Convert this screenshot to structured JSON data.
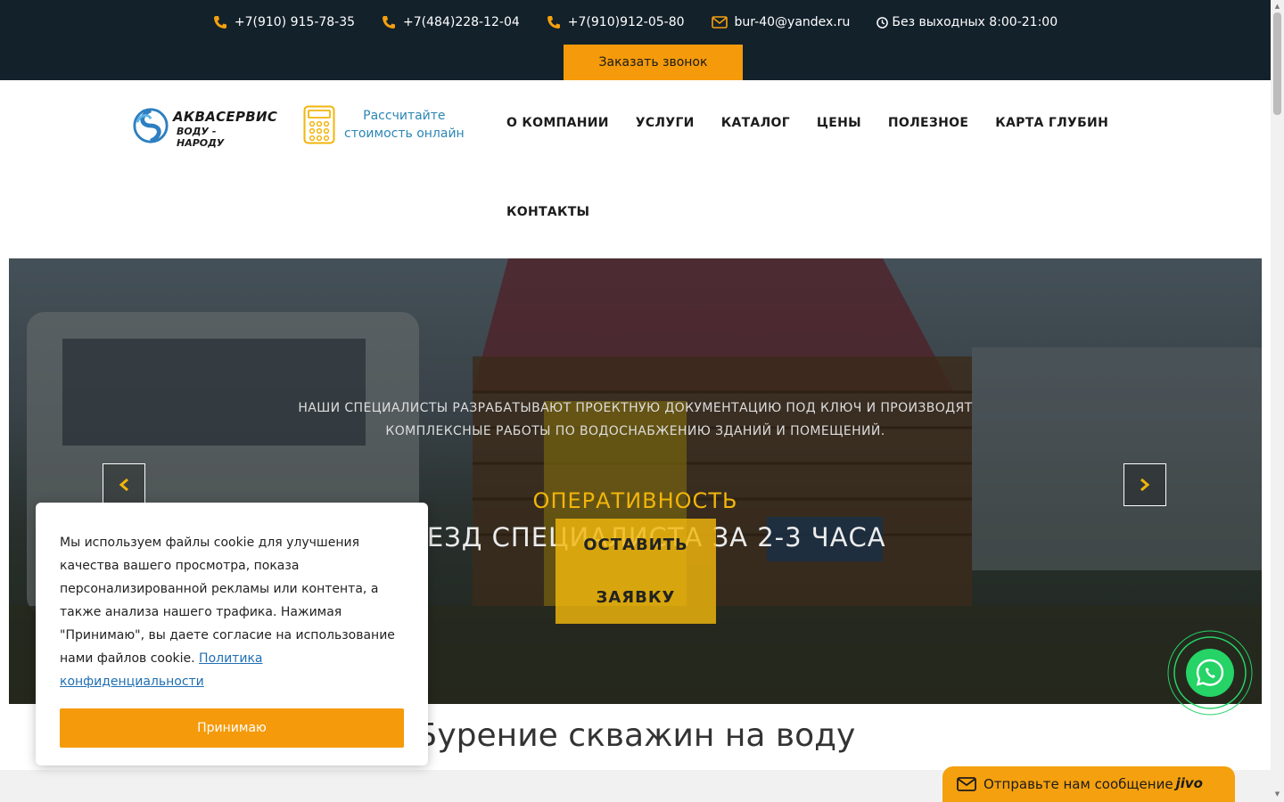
{
  "topbar": {
    "contacts": [
      {
        "icon": "phone-icon",
        "text": "+7(910) 915-78-35"
      },
      {
        "icon": "phone-icon",
        "text": "+7(484)228-12-04"
      },
      {
        "icon": "phone-icon",
        "text": "+7(910)912-05-80"
      },
      {
        "icon": "envelope-icon",
        "text": "bur-40@yandex.ru"
      },
      {
        "icon": "clock-icon",
        "text": "Без выходных 8:00-21:00"
      }
    ],
    "callback_label": "Заказать звонок"
  },
  "header": {
    "logo": {
      "line1": "АКВАСЕРВИС",
      "line2": "ВОДУ - НАРОДУ"
    },
    "calc": {
      "line1": "Рассчитайте",
      "line2": "стоимость онлайн"
    },
    "nav": [
      "О КОМПАНИИ",
      "УСЛУГИ",
      "КАТАЛОГ",
      "ЦЕНЫ",
      "ПОЛЕЗНОЕ",
      "КАРТА ГЛУБИН",
      "КОНТАКТЫ"
    ]
  },
  "hero": {
    "description_line1": "НАШИ СПЕЦИАЛИСТЫ РАЗРАБАТЫВАЮТ ПРОЕКТНУЮ ДОКУМЕНТАЦИЮ ПОД КЛЮЧ И ПРОИЗВОДЯТ",
    "description_line2": "КОМПЛЕКСНЫЕ РАБОТЫ ПО ВОДОСНАБЖЕНИЮ ЗДАНИЙ И ПОМЕЩЕНИЙ.",
    "subtitle": "ОПЕРАТИВНОСТЬ",
    "title": "ВЫЕЗД СПЕЦИАЛИСТА ЗА 2-3 ЧАСА",
    "button_line1": "ОСТАВИТЬ",
    "button_line2": "ЗАЯВКУ"
  },
  "section": {
    "title": "Бурение скважин на воду"
  },
  "cookie": {
    "text": "Мы используем файлы cookie для улучшения качества вашего просмотра, показа персонализированной рекламы или контента, а также анализа нашего трафика. Нажимая \"Принимаю\", вы даете согласие на использование нами файлов cookie.",
    "link": "Политика конфиденциальности",
    "accept_label": "Принимаю"
  },
  "chat": {
    "label": "Отправьте нам сообщение",
    "brand": "jivo"
  },
  "colors": {
    "topbar": "#13212b",
    "accent": "#f59a0a",
    "hero_accent": "#f2b50b",
    "link": "#1f6fb3",
    "whatsapp": "#25d366"
  }
}
